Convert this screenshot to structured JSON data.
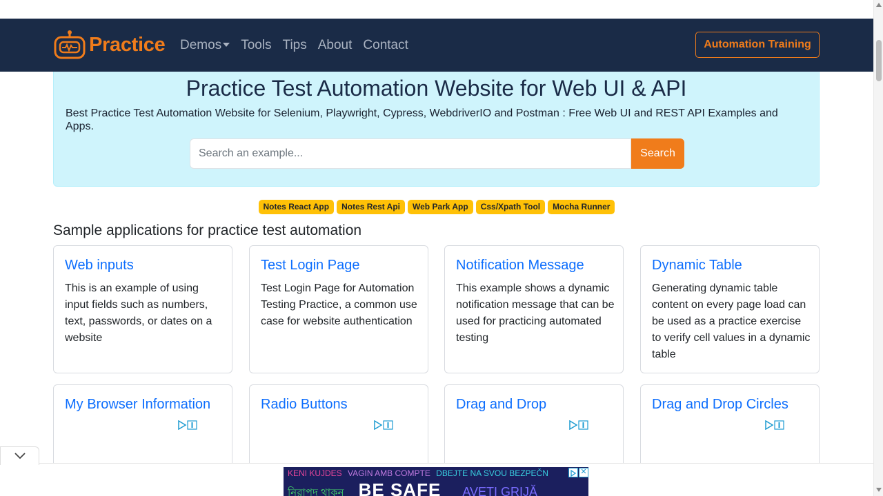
{
  "navbar": {
    "brand": "Practice",
    "links": [
      "Demos",
      "Tools",
      "Tips",
      "About",
      "Contact"
    ],
    "cta": "Automation Training"
  },
  "hero": {
    "title": "Practice Test Automation Website for Web UI & API",
    "description": "Best Practice Test Automation Website for Selenium, Playwright, Cypress, WebdriverIO and Postman : Free Web UI and REST API Examples and Apps.",
    "search_placeholder": "Search an example...",
    "search_button": "Search"
  },
  "badges": [
    "Notes React App",
    "Notes Rest Api",
    "Web Park App",
    "Css/Xpath Tool",
    "Mocha Runner"
  ],
  "section_title": "Sample applications for practice test automation",
  "cards": [
    {
      "title": "Web inputs",
      "text": "This is an example of using input fields such as numbers, text, passwords, or dates on a website"
    },
    {
      "title": "Test Login Page",
      "text": "Test Login Page for Automation Testing Practice, a common use case for website authentication"
    },
    {
      "title": "Notification Message",
      "text": "This example shows a dynamic notification message that can be used for practicing automated testing"
    },
    {
      "title": "Dynamic Table",
      "text": "Generating dynamic table content on every page load can be used as a practice exercise to verify cell values in a dynamic table"
    },
    {
      "title": "My Browser Information",
      "text": ""
    },
    {
      "title": "Radio Buttons",
      "text": ""
    },
    {
      "title": "Drag and Drop",
      "text": ""
    },
    {
      "title": "Drag and Drop Circles",
      "text": ""
    }
  ],
  "ad": {
    "line1_parts": [
      "KENI KUJDES",
      "VAGIN AMB COMPTE",
      "DBEJTE NA SVOU BEZPEČN"
    ],
    "line2_parts": [
      "নিরাপদ থাকুন",
      "BE SAFE",
      "AVEȚI GRIJĂ"
    ],
    "close": "✕"
  },
  "colors": {
    "navbar_bg": "#1a2b47",
    "accent": "#f07c1b",
    "hero_bg": "#cff4fc",
    "badge": "#ffc107",
    "link": "#0d6efd"
  }
}
